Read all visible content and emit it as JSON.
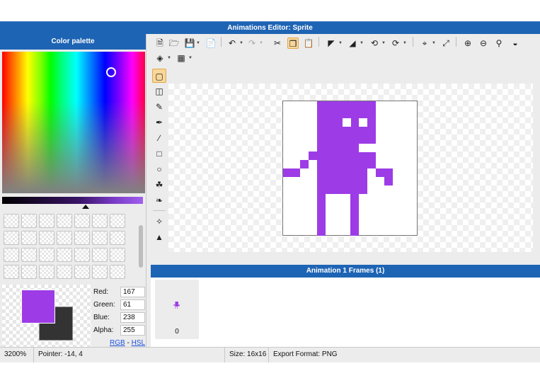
{
  "window": {
    "title": "Animations Editor: Sprite"
  },
  "palette": {
    "header": "Color palette",
    "spectrum_colors": [
      "#ff0000",
      "#ffff00",
      "#00ff00",
      "#00ffff",
      "#0000ff",
      "#ff00ff"
    ],
    "foreground_color": "#9d3ce6",
    "background_color": "#333333",
    "fields": [
      {
        "label": "Red:",
        "value": "167"
      },
      {
        "label": "Green:",
        "value": "61"
      },
      {
        "label": "Blue:",
        "value": "238"
      },
      {
        "label": "Alpha:",
        "value": "255"
      }
    ],
    "mode_rgb": "RGB",
    "mode_sep": " - ",
    "mode_hsl": "HSL"
  },
  "toolbar": {
    "icons": [
      "new-file-icon",
      "open-folder-icon",
      "save-icon",
      "export-icon",
      "undo-icon",
      "redo-icon",
      "cut-icon",
      "copy-icon",
      "paste-icon",
      "flip-horizontal-icon",
      "flip-vertical-icon",
      "rotate-left-icon",
      "rotate-right-icon",
      "crop-icon",
      "resize-icon",
      "zoom-in-icon",
      "zoom-out-icon",
      "zoom-fit-icon",
      "invert-colors-icon",
      "layers-icon",
      "grid-icon"
    ]
  },
  "tools": [
    "select-tool-icon",
    "eraser-icon",
    "pencil-icon",
    "brush-icon",
    "line-icon",
    "rectangle-icon",
    "ellipse-icon",
    "fill-bucket-icon",
    "eyedropper-icon",
    "move-icon",
    "transform-icon"
  ],
  "frames": {
    "header": "Animation 1 Frames (1)",
    "items": [
      {
        "number": "0"
      }
    ]
  },
  "status": {
    "zoom": "3200%",
    "pointer": "Pointer: -14, 4",
    "size": "Size: 16x16",
    "export_format": "Export Format: PNG"
  }
}
